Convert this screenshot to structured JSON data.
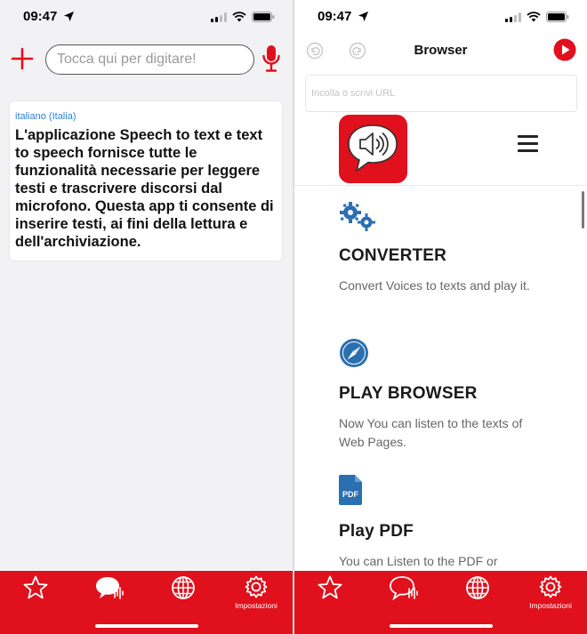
{
  "left_screen": {
    "status": {
      "time": "09:47"
    },
    "header": {
      "search_placeholder": "Tocca qui per digitare!"
    },
    "card": {
      "language": "italiano (Italia)",
      "text": "L'applicazione Speech to text e text to speech fornisce tutte le funzionalità necessarie per leggere testi e trascrivere discorsi dal microfono. Questa app ti consente di inserire testi, ai fini della lettura e dell'archiviazione."
    },
    "tabs": [
      {
        "icon": "star-icon",
        "label": ""
      },
      {
        "icon": "speech-bubble-icon",
        "label": ""
      },
      {
        "icon": "globe-icon",
        "label": ""
      },
      {
        "icon": "gear-icon",
        "label": "Impostazioni"
      }
    ]
  },
  "right_screen": {
    "status": {
      "time": "09:47"
    },
    "header": {
      "title": "Browser",
      "url_placeholder": "Incolla o scrivi URL"
    },
    "features": [
      {
        "icon": "gears-icon",
        "title": "CONVERTER",
        "description": "Convert Voices to texts and play it."
      },
      {
        "icon": "compass-icon",
        "title": "PLAY BROWSER",
        "description": "Now You can listen to the texts of Web Pages."
      },
      {
        "icon": "pdf-icon",
        "title": "Play PDF",
        "description": "You can Listen to the PDF or"
      }
    ],
    "tabs": [
      {
        "icon": "star-icon",
        "label": ""
      },
      {
        "icon": "speech-bubble-icon",
        "label": ""
      },
      {
        "icon": "globe-icon",
        "label": ""
      },
      {
        "icon": "gear-icon",
        "label": "Impostazioni"
      }
    ]
  },
  "colors": {
    "accent": "#e0101c",
    "link_blue": "#2e7fd1",
    "icon_blue": "#2a6fb0"
  }
}
